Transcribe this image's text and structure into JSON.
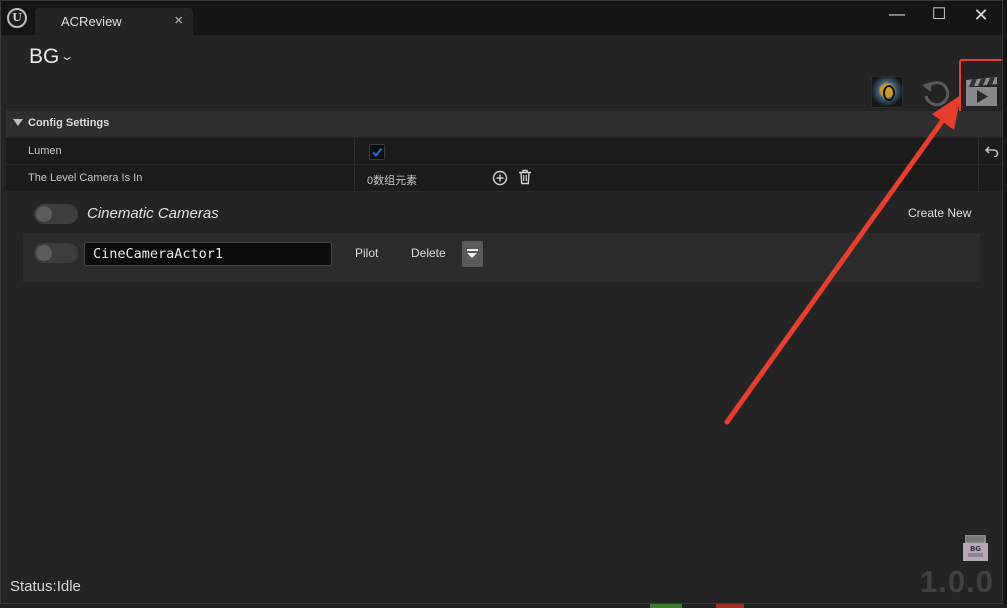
{
  "window": {
    "tab_title": "ACReview",
    "tab_close": "×",
    "minimize": "—",
    "maximize": "☐",
    "close": "✕"
  },
  "editor": {
    "blueprint_name": "BG",
    "chevron": "⌄"
  },
  "config": {
    "section_title": "Config Settings",
    "rows": [
      {
        "label": "Lumen",
        "checked": true
      },
      {
        "label": "The Level Camera Is In",
        "value": "0数组元素"
      }
    ]
  },
  "cameras": {
    "title": "Cinematic Cameras",
    "create_new": "Create New",
    "items": [
      {
        "name": "CineCameraActor1",
        "pilot": "Pilot",
        "delete": "Delete",
        "enabled": false
      }
    ]
  },
  "footer": {
    "status": "Status:Idle",
    "version": "1.0.0",
    "icon_label": "BG"
  },
  "colors": {
    "highlight": "#e53e2f",
    "background": "#242424",
    "checkbox_accent": "#1f6fe0"
  }
}
